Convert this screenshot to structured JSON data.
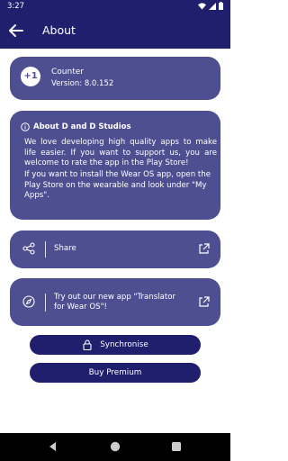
{
  "status_bar": {
    "time": "3:27"
  },
  "app_bar": {
    "title": "About"
  },
  "counter_card": {
    "logo": "+1",
    "name": "Counter",
    "version": "Version: 8.0.152"
  },
  "about_card": {
    "heading": "About D and D Studios",
    "paragraph1": "We love developing high quality apps to make life easier. If you want to support us, you are welcome to rate the app in the Play Store!",
    "paragraph2": "If you want to install the Wear OS app, open the Play Store on the wearable and look under \"My Apps\"."
  },
  "share_card": {
    "label": "Share"
  },
  "promo_card": {
    "label": "Try out our new app \"Translator for Wear OS\"!"
  },
  "buttons": {
    "sync_label": "Synchronise",
    "buy_label": "Buy Premium"
  },
  "colors": {
    "primary": "#1f1f6e",
    "card": "#4e4f90"
  },
  "icons": [
    "back-arrow-icon",
    "info-icon",
    "share-icon",
    "external-link-icon",
    "compass-icon",
    "lock-icon",
    "wifi-icon",
    "battery-icon"
  ]
}
